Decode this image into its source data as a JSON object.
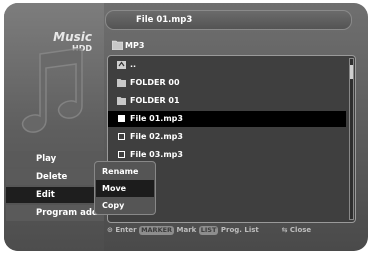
{
  "left": {
    "title": "Music",
    "source": "HDD",
    "menu": [
      {
        "label": "Play"
      },
      {
        "label": "Delete"
      },
      {
        "label": "Edit"
      },
      {
        "label": "Program add"
      }
    ],
    "active_menu": "Edit"
  },
  "popup": {
    "items": [
      {
        "label": "Rename"
      },
      {
        "label": "Move"
      },
      {
        "label": "Copy"
      }
    ],
    "active": "Move"
  },
  "header": {
    "title": "File 01.mp3"
  },
  "current_folder": {
    "label": "MP3"
  },
  "list": {
    "rows": [
      {
        "type": "up",
        "label": ".."
      },
      {
        "type": "folder",
        "label": "FOLDER 00"
      },
      {
        "type": "folder",
        "label": "FOLDER 01"
      },
      {
        "type": "file",
        "label": "File 01.mp3",
        "selected": true
      },
      {
        "type": "file",
        "label": "File 02.mp3"
      },
      {
        "type": "file",
        "label": "File 03.mp3"
      }
    ]
  },
  "footer": {
    "enter": "Enter",
    "marker_badge": "MARKER",
    "mark": "Mark",
    "list_badge": "LIST",
    "prog_list": "Prog. List",
    "close": "Close"
  },
  "colors": {
    "screen_bg": "#555555",
    "selected_row": "#000000",
    "text": "#ffffff"
  }
}
